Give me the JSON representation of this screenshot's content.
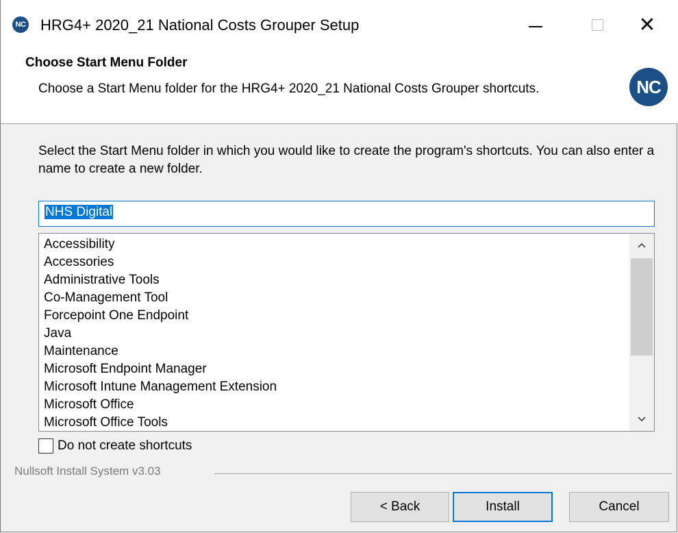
{
  "window": {
    "title": "HRG4+ 2020_21 National Costs Grouper Setup",
    "icon_text": "NC",
    "controls": {
      "minimize": "—",
      "maximize": "□",
      "close": "✕"
    }
  },
  "header": {
    "title": "Choose Start Menu Folder",
    "subtitle": "Choose a Start Menu folder for the HRG4+ 2020_21 National Costs Grouper shortcuts.",
    "logo_text": "NC"
  },
  "body": {
    "description": "Select the Start Menu folder in which you would like to create the program's shortcuts. You can also enter a name to create a new folder.",
    "folder_input_value": "NHS Digital",
    "folders": [
      "Accessibility",
      "Accessories",
      "Administrative Tools",
      "Co-Management Tool",
      "Forcepoint One Endpoint",
      "Java",
      "Maintenance",
      "Microsoft Endpoint Manager",
      "Microsoft Intune Management Extension",
      "Microsoft Office",
      "Microsoft Office Tools"
    ],
    "scroll_up_icon": "chevron-up-icon",
    "scroll_down_icon": "chevron-down-icon",
    "no_shortcuts_label": "Do not create shortcuts",
    "no_shortcuts_checked": false
  },
  "footer": {
    "branding": "Nullsoft Install System v3.03",
    "back_label": "< Back",
    "install_label": "Install",
    "cancel_label": "Cancel"
  },
  "colors": {
    "brand_blue": "#1b4f86",
    "accent": "#0078d7"
  }
}
